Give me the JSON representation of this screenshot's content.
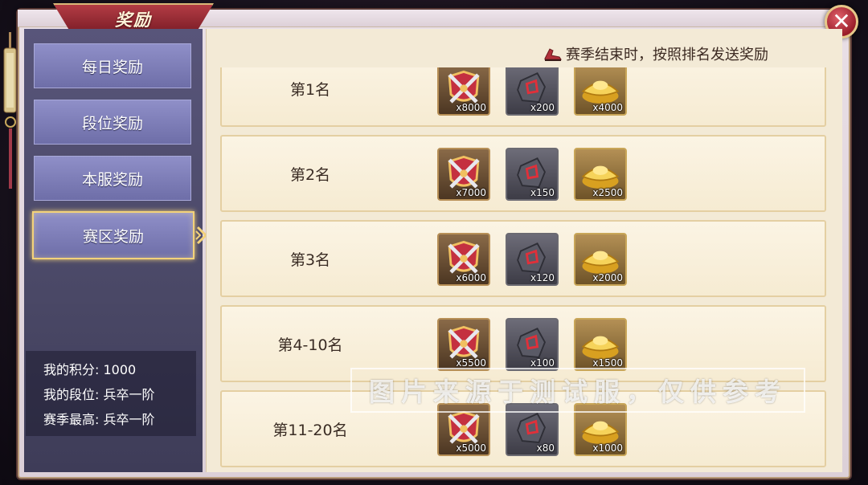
{
  "window": {
    "title": "奖励",
    "close_symbol": "✕"
  },
  "sidebar": {
    "items": [
      {
        "label": "每日奖励",
        "active": false
      },
      {
        "label": "段位奖励",
        "active": false
      },
      {
        "label": "本服奖励",
        "active": false
      },
      {
        "label": "赛区奖励",
        "active": true
      }
    ]
  },
  "stats": {
    "points": "我的积分: 1000",
    "rank_level": "我的段位: 兵卒一阶",
    "season_best": "赛季最高: 兵卒一阶"
  },
  "notice": "赛季结束时，按照排名发送奖励",
  "rewards": [
    {
      "rank": "第1名",
      "items": [
        {
          "icon": "crossed-swords-shield-icon",
          "qty": "x8000"
        },
        {
          "icon": "red-rune-stone-icon",
          "qty": "x200"
        },
        {
          "icon": "gold-ingot-icon",
          "qty": "x4000"
        }
      ]
    },
    {
      "rank": "第2名",
      "items": [
        {
          "icon": "crossed-swords-shield-icon",
          "qty": "x7000"
        },
        {
          "icon": "red-rune-stone-icon",
          "qty": "x150"
        },
        {
          "icon": "gold-ingot-icon",
          "qty": "x2500"
        }
      ]
    },
    {
      "rank": "第3名",
      "items": [
        {
          "icon": "crossed-swords-shield-icon",
          "qty": "x6000"
        },
        {
          "icon": "red-rune-stone-icon",
          "qty": "x120"
        },
        {
          "icon": "gold-ingot-icon",
          "qty": "x2000"
        }
      ]
    },
    {
      "rank": "第4-10名",
      "items": [
        {
          "icon": "crossed-swords-shield-icon",
          "qty": "x5500"
        },
        {
          "icon": "red-rune-stone-icon",
          "qty": "x100"
        },
        {
          "icon": "gold-ingot-icon",
          "qty": "x1500"
        }
      ]
    },
    {
      "rank": "第11-20名",
      "items": [
        {
          "icon": "crossed-swords-shield-icon",
          "qty": "x5000"
        },
        {
          "icon": "red-rune-stone-icon",
          "qty": "x80"
        },
        {
          "icon": "gold-ingot-icon",
          "qty": "x1000"
        }
      ]
    }
  ],
  "watermark": "图片来源于测试服，仅供参考",
  "colors": {
    "accent_red": "#9a1e2a",
    "gold": "#f3d27a",
    "sidebar": "#4a4866",
    "panel": "#f3ead6"
  }
}
